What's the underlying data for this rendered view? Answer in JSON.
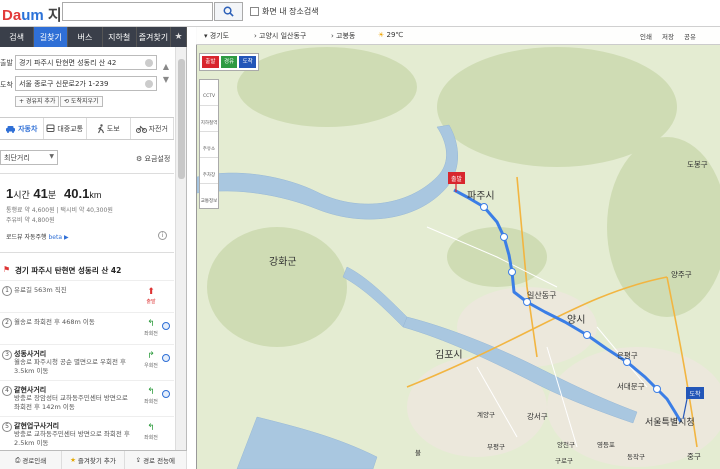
{
  "topbar": {
    "logo_prefix": "D",
    "logo_mid": "a",
    "logo_brand": "um",
    "logo_title": "지도",
    "search_value": "",
    "checkbox_label": "화면 내 장소검색"
  },
  "tabs": [
    {
      "label": "검색",
      "active": false
    },
    {
      "label": "길찾기",
      "active": true
    },
    {
      "label": "버스",
      "active": false
    },
    {
      "label": "지하철",
      "active": false
    },
    {
      "label": "즐겨찾기",
      "active": false
    }
  ],
  "route": {
    "origin_label": "출발",
    "origin_value": "경기 파주시 탄현면 성동리 산 42",
    "dest_label": "도착",
    "dest_value": "서울 종로구 신문로2가 1-239",
    "add_waypoint": "+ 경유지 추가",
    "reverse": "⟲ 도착지우기"
  },
  "modes": [
    {
      "label": "자동차",
      "icon": "car-icon",
      "active": true
    },
    {
      "label": "대중교통",
      "icon": "bus-icon",
      "active": false
    },
    {
      "label": "도보",
      "icon": "walk-icon",
      "active": false
    },
    {
      "label": "자전거",
      "icon": "bicycle-icon",
      "active": false
    }
  ],
  "option": {
    "selected": "최단거리",
    "fare_label": "요금설정"
  },
  "summary": {
    "hours": "1",
    "hours_unit": "시간",
    "minutes": "41",
    "minutes_unit": "분",
    "distance": "40.1",
    "distance_unit": "km",
    "detail1": "통행료 약 4,600원 | 택시비 약 40,300원",
    "detail2": "주유비 약 4,800원",
    "roadview": "로드뷰 자동주행",
    "roadview_beta": "beta"
  },
  "start_point": "경기 파주시 탄현면 성동리 산 42",
  "steps": [
    {
      "num": "1",
      "title": "",
      "desc": "유료길 563m 직진",
      "dir_label": "출발",
      "dir_color": "red"
    },
    {
      "num": "2",
      "title": "",
      "desc": "월송로 좌회전 후 468m 이동",
      "dir_label": "좌회전",
      "dir_color": "green"
    },
    {
      "num": "3",
      "title": "성동사거리",
      "desc": "월송로 파주시청 공순 별면으로 우회전 후 3.5km 이동",
      "dir_label": "우회전",
      "dir_color": "green"
    },
    {
      "num": "4",
      "title": "갈현사거리",
      "desc": "방충로 장암성터 교하동주민센터 방면으로 좌회전 후 142m 이동",
      "dir_label": "좌회전",
      "dir_color": "green"
    },
    {
      "num": "5",
      "title": "갈현업구사거리",
      "desc": "방충로 교하동주민센터 방면으로 좌회전 후 2.5km 이동",
      "dir_label": "좌회전",
      "dir_color": "green"
    }
  ],
  "bottombar": [
    {
      "label": "경로인쇄",
      "icon": "print-icon"
    },
    {
      "label": "즐겨찾기 추가",
      "icon": "star-icon"
    },
    {
      "label": "경로 전능에",
      "icon": "share-icon"
    }
  ],
  "map": {
    "breadcrumb_region": "경기도",
    "breadcrumb_city": "고양시 일산동구",
    "breadcrumb_dong": "고봉동",
    "temperature": "29℃",
    "top_right": [
      "인쇄",
      "저장",
      "공유"
    ],
    "legend": [
      "출발",
      "경유",
      "도착"
    ],
    "tools": [
      "CCTV",
      "지하철역",
      "주유소",
      "주차장",
      "교통정보"
    ],
    "start_flag": "출발",
    "end_flag": "도착",
    "labels": [
      {
        "text": "파주시",
        "size": "big"
      },
      {
        "text": "강화군",
        "size": "big"
      },
      {
        "text": "김포시",
        "size": "big"
      },
      {
        "text": "일산동구",
        "size": "mid"
      },
      {
        "text": "서울특별시청",
        "size": "big"
      },
      {
        "text": "양시",
        "size": "big"
      },
      {
        "text": "은평구",
        "size": "mid"
      },
      {
        "text": "서대문구",
        "size": "mid"
      },
      {
        "text": "중구",
        "size": "mid"
      },
      {
        "text": "도봉구",
        "size": "mid"
      },
      {
        "text": "양주구",
        "size": "mid"
      },
      {
        "text": "강서구",
        "size": "mid"
      },
      {
        "text": "계양구",
        "size": "small"
      },
      {
        "text": "부평구",
        "size": "small"
      },
      {
        "text": "양천구",
        "size": "small"
      },
      {
        "text": "구로구",
        "size": "small"
      },
      {
        "text": "영등포",
        "size": "small"
      },
      {
        "text": "동작구",
        "size": "small"
      },
      {
        "text": "불",
        "size": "small"
      }
    ]
  },
  "colors": {
    "accent": "#2f6fd6",
    "route": "#3b7ee6",
    "start": "#d8262d",
    "end": "#2356b8"
  }
}
